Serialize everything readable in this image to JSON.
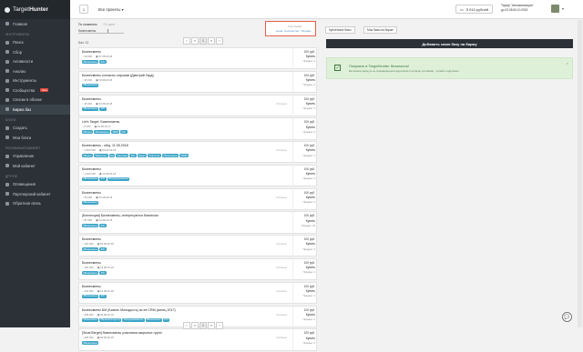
{
  "app": {
    "brand_light": "Target",
    "brand_bold": "Hunter"
  },
  "sidebar": {
    "main_items": [
      {
        "label": "Главная"
      }
    ],
    "sections": [
      {
        "title": "ИНСТРУМЕНТЫ",
        "items": [
          {
            "label": "Поиск"
          },
          {
            "label": "Сбор"
          },
          {
            "label": "Активности"
          },
          {
            "label": "Анализ"
          },
          {
            "label": "Инструменты"
          },
          {
            "label": "Сообщества",
            "badge": "New"
          },
          {
            "label": "Списки в облаке"
          },
          {
            "label": "Биржа баз",
            "active": true
          }
        ]
      },
      {
        "title": "БЛОГИ",
        "items": [
          {
            "label": "Создать"
          },
          {
            "label": "Мои блоги"
          }
        ]
      },
      {
        "title": "РЕКЛАМНЫЙ КАБИНЕТ",
        "items": [
          {
            "label": "Управление"
          },
          {
            "label": "Мой кабинет"
          }
        ]
      },
      {
        "title": "ДРУГОЕ",
        "items": [
          {
            "label": "Оповещения"
          },
          {
            "label": "Партнерский кабинет"
          },
          {
            "label": "Обратная связь"
          }
        ]
      }
    ]
  },
  "topbar": {
    "project_num": "1",
    "projects_label": "Все проекты ▾",
    "balance": "5 010 рублей",
    "tariff_line1": "Тариф \"Автоматизация\"",
    "tariff_line2": "до 03.08.06.10.2019"
  },
  "filter": {
    "sort_by_name": "По названию",
    "sort_by_other": "По цене",
    "input_value": "бизнесмены",
    "sort_title": "Сортировка",
    "sort_options": [
      "Цена",
      "Количество",
      "Продаж"
    ],
    "tabs": [
      "Купленные базы",
      "Мои базы на бирже"
    ]
  },
  "list": {
    "count": "Баз: 12",
    "pager": [
      "‹",
      "«",
      "1",
      "»",
      "›"
    ],
    "cards": [
      {
        "title": "Бизнесмены",
        "meta": [
          "36 000",
          "27.08.20.18"
        ],
        "tags": [
          "#Бизнесмены",
          "#VK"
        ],
        "status": "",
        "price": "100 руб.",
        "buy": "Купить",
        "sold": "Продано: 4"
      },
      {
        "title": "Бизнесмены согласно опросам (Дмитрий Гард)",
        "meta": [
          "36 000",
          "03.08.20.18"
        ],
        "tags": [
          "#Бизнесмены"
        ],
        "status": "",
        "price": "100 руб.",
        "buy": "Купить",
        "sold": "Продано: 3"
      },
      {
        "title": "Бизнесмены",
        "meta": [
          "36 000",
          "03.08.20.18"
        ],
        "tags": [
          "#Бизнесмены",
          "#VK"
        ],
        "status": "Описание",
        "price": "100 руб.",
        "buy": "Купить",
        "sold": "Продано: 3"
      },
      {
        "title": "Let's Target. Бизнесмены",
        "meta": [
          "8 000",
          "19.08.10.17"
        ],
        "tags": [
          "#Бизнес",
          "#бизнесмены",
          "#B2B",
          "#VK"
        ],
        "status": "",
        "price": "100 руб.",
        "buy": "Купить",
        "sold": "Продано: 6"
      },
      {
        "title": "Бизнесмены - общ. 11.05.2018",
        "meta": [
          "1 500 000",
          "09.02.19.18"
        ],
        "tags": [
          "#Бизнес",
          "#маркетинг",
          "#вк",
          "#реклама",
          "#VK",
          "#аудит",
          "#таргетинг",
          "#бизнесмены",
          "#SMM"
        ],
        "status": "Описание",
        "price": "100 руб.",
        "buy": "Купить",
        "sold": "Продано: 1"
      },
      {
        "title": "Бизнесмены",
        "meta": [
          "1 000 000",
          "13.08.20.18"
        ],
        "tags": [
          "#Бизнесмены",
          "#VK",
          "#Предприниматели"
        ],
        "status": "",
        "price": "100 руб.",
        "buy": "Купить",
        "sold": "Продано: 3"
      },
      {
        "title": "Бизнесмены",
        "meta": [
          "25 000",
          "03.08.20.18"
        ],
        "tags": [
          "#Бизнесмены"
        ],
        "status": "Описание",
        "price": "100 руб.",
        "buy": "Купить",
        "sold": "Продано: 3"
      },
      {
        "title": "[Коллекция] Бизнесмены, интересуются бизнесом",
        "meta": [
          "87 000",
          "03.08.20.18"
        ],
        "tags": [
          "#Бизнесмены",
          "#VK"
        ],
        "status": "",
        "price": "100 руб.",
        "buy": "Купить",
        "sold": "Продано: 20"
      },
      {
        "title": "Бизнесмены",
        "meta": [
          "102 000",
          "03.08.20.18"
        ],
        "tags": [
          "#Бизнесмены",
          "#VK"
        ],
        "status": "Описание",
        "price": "100 руб.",
        "buy": "Купить",
        "sold": "Продано: 3"
      },
      {
        "title": "Бизнесмены",
        "meta": [
          "192 000",
          "13.08.20.18"
        ],
        "tags": [
          "#Бизнесмены",
          "#VK"
        ],
        "status": "Описание",
        "price": "100 руб.",
        "buy": "Купить",
        "sold": "Продано: 2"
      },
      {
        "title": "Бизнесмены",
        "meta": [
          "192 000",
          "13.08.20.18"
        ],
        "tags": [
          "#Бизнесмены",
          "#VK"
        ],
        "status": "Описание",
        "price": "100 руб.",
        "buy": "Купить",
        "sold": "Продано: 2"
      },
      {
        "title": "Бизнесмены БМ (Бизнес Молодость) из ее CRM (конец 2017)",
        "meta": [
          "295 000",
          "03.08.20.18"
        ],
        "tags": [
          "#бизнесмены",
          "#БизнесМолодость",
          "#предприниматели",
          "#Бизнесмены",
          "#VK"
        ],
        "status": "Описание",
        "price": "100 руб.",
        "buy": "Купить",
        "sold": "Продано: 4"
      },
      {
        "title": "[SmartTarget] бизнесмены участники закрытых групп",
        "meta": [
          "428 000",
          "03.08.20.18"
        ],
        "tags": [
          "#Бизнесмены"
        ],
        "status": "Описание",
        "price": "100 руб.",
        "buy": "Купить",
        "sold": "Продано: 4"
      }
    ]
  },
  "right": {
    "add_button": "Добавить свою базу на биржу",
    "promo_title": "Покупать в TargetHunter безопасно!",
    "promo_text": "Вы можете вернуть не понравившуюся аудиторию (согласно условиям) - читайте подробнее."
  },
  "colors": {
    "sidebar": "#2b3137",
    "tag": "#3ca4c8",
    "highlight": "#e0614c",
    "promo": "#dff0d8"
  }
}
